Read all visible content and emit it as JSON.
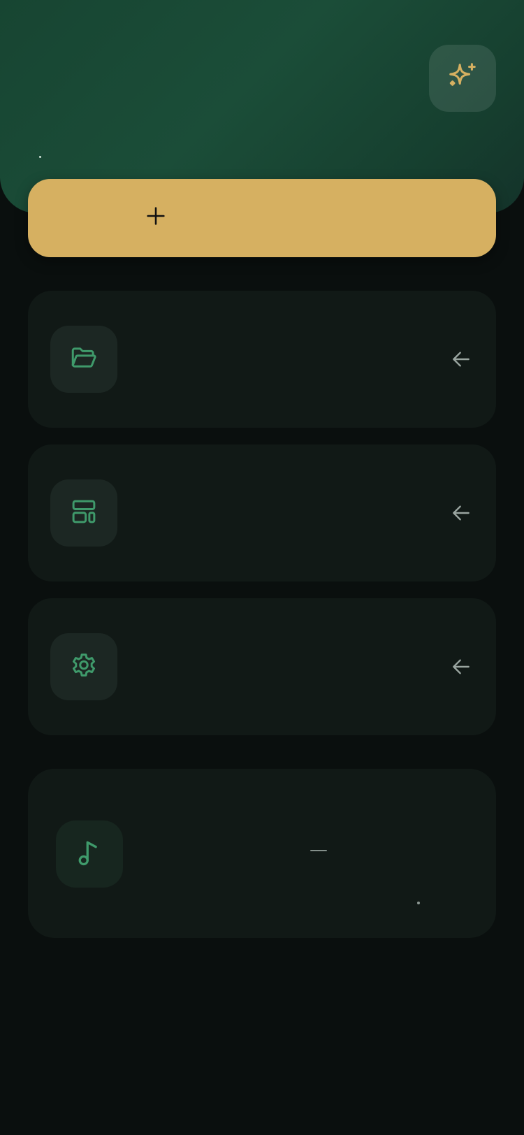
{
  "header": {
    "sparkle_icon": "sparkle-icon"
  },
  "primary_action": {
    "icon": "plus-icon",
    "label": ""
  },
  "menu": {
    "items": [
      {
        "icon": "folder-open-icon",
        "label": "",
        "arrow_icon": "arrow-left-icon"
      },
      {
        "icon": "layout-grid-icon",
        "label": "",
        "arrow_icon": "arrow-left-icon"
      },
      {
        "icon": "gear-icon",
        "label": "",
        "arrow_icon": "arrow-left-icon"
      }
    ]
  },
  "player": {
    "icon": "music-note-icon",
    "track_title": "—"
  },
  "colors": {
    "accent_gold": "#d6b061",
    "accent_green": "#3f9a6b",
    "header_green": "#1b4d38",
    "background": "#0a0f0e",
    "card": "#111916"
  }
}
